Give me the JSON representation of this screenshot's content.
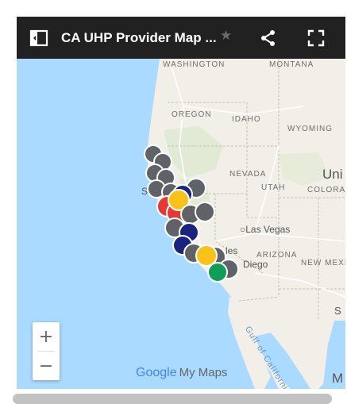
{
  "header": {
    "title": "CA UHP Provider Map ...",
    "star_icon": "star-icon",
    "share_icon": "share-icon",
    "fullscreen_icon": "fullscreen-icon",
    "sidebar_icon": "sidebar-toggle-icon"
  },
  "map_labels": {
    "washington": "WASHINGTON",
    "montana": "MONTANA",
    "oregon": "OREGON",
    "idaho": "IDAHO",
    "wyoming": "WYOMING",
    "nevada": "NEVADA",
    "utah": "UTAH",
    "colorado": "COLORAD",
    "uni": "Uni",
    "las_vegas": "Las Vegas",
    "arizona": "ARIZONA",
    "new_mexico": "NEW MEXIC",
    "san_prefix": "San",
    "diego": "Diego",
    "les": "les",
    "gulf": "Gulf of California",
    "s": "S",
    "m": "M"
  },
  "zoom": {
    "in_label": "+",
    "out_label": "−"
  },
  "logo": {
    "google": "Google",
    "my_maps": "My Maps"
  },
  "colors": {
    "topbar": "#212121",
    "water": "#aadaff",
    "land": "#f2efe9",
    "marker_grey": "#5f6368",
    "marker_navy": "#1a237e",
    "marker_red": "#e53935",
    "marker_yellow": "#f9c21b",
    "marker_green": "#0f9d58"
  }
}
